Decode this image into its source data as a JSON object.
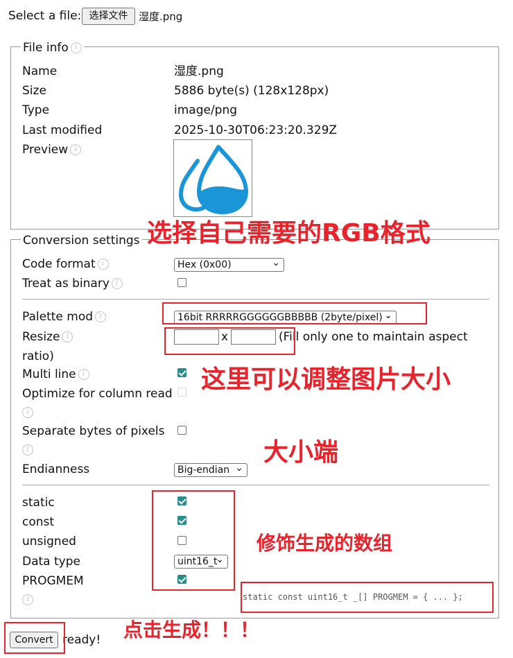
{
  "file_select": {
    "label": "Select a file:",
    "button": "选择文件",
    "filename": "湿度.png"
  },
  "file_info": {
    "legend": "File info",
    "rows": [
      {
        "key": "Name",
        "value": "湿度.png"
      },
      {
        "key": "Size",
        "value": "5886 byte(s) (128x128px)"
      },
      {
        "key": "Type",
        "value": "image/png"
      },
      {
        "key": "Last modified",
        "value": "2025-10-30T06:23:20.329Z"
      }
    ],
    "preview_label": "Preview"
  },
  "conversion": {
    "legend": "Conversion settings",
    "code_format_label": "Code format",
    "code_format_value": "Hex (0x00)",
    "treat_binary_label": "Treat as binary",
    "palette_label": "Palette mod",
    "palette_value": "16bit RRRRRGGGGGGBBBBB (2byte/pixel)",
    "resize_label": "Resize",
    "resize_x": "x",
    "resize_note": "(Fill only one to maintain aspect",
    "resize_note2": "ratio)",
    "multiline_label": "Multi line",
    "optimize_label": "Optimize for column read",
    "separate_label": "Separate bytes of pixels",
    "endianness_label": "Endianness",
    "endianness_value": "Big-endian",
    "static_label": "static",
    "const_label": "const",
    "unsigned_label": "unsigned",
    "datatype_label": "Data type",
    "datatype_value": "uint16_t",
    "progmem_label": "PROGMEM",
    "code_preview": "static const uint16_t _[] PROGMEM = { ... };"
  },
  "convert": {
    "button": "Convert",
    "status": "ready!"
  },
  "annotations": {
    "rgb": "选择自己需要的RGB格式",
    "resize": "这里可以调整图片大小",
    "endian": "大小端",
    "modifiers": "修饰生成的数组",
    "click": "点击生成！！！"
  },
  "colors": {
    "annotation_red": "#e8232b",
    "checkbox_teal": "#2a8c8c",
    "drop_blue": "#1a96d8"
  }
}
